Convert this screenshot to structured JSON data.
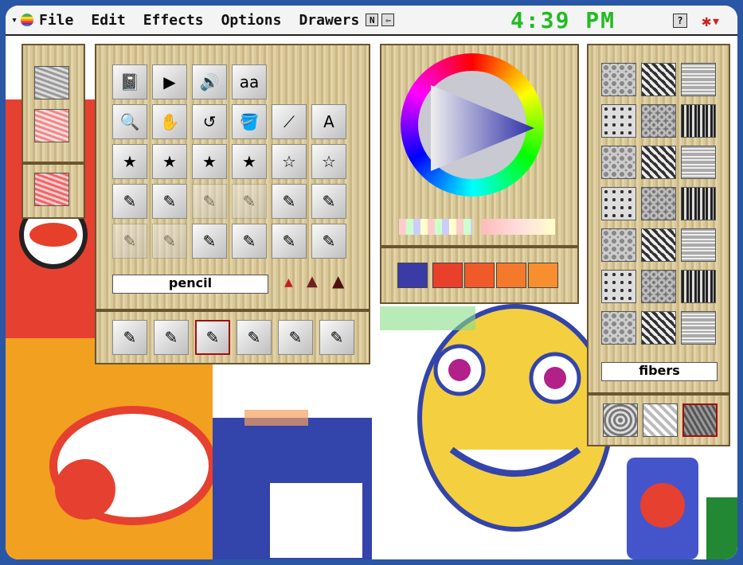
{
  "menu": {
    "items": [
      "File",
      "Edit",
      "Effects",
      "Options",
      "Drawers"
    ],
    "clock": "4:39 PM"
  },
  "tools_drawer": {
    "selected_label": "pencil",
    "tools": [
      "notebook-icon",
      "play-icon",
      "speaker-icon",
      "text-icon",
      "magnifier-icon",
      "hand-icon",
      "undo-icon",
      "paint-bucket-icon",
      "eyedropper-icon",
      "stamp-icon",
      "star-stamp-1",
      "star-stamp-2",
      "star-stamp-3",
      "star-stamp-4",
      "star-stamp-5",
      "star-stamp-6",
      "marker-icon",
      "glitter-icon",
      "drip-icon",
      "tube-icon",
      "brush-icon",
      "ink-bottle-icon",
      "crayon-icon",
      "chalk-icon",
      "brush-2-icon",
      "pen-icon",
      "nib-icon",
      "brush-3-icon"
    ],
    "bottom_tools": [
      "paint-brush-icon",
      "green-pencil-icon",
      "pencil-icon",
      "water-drop-icon",
      "crayon-icon",
      "spray-can-icon"
    ]
  },
  "color": {
    "selected": "#3b3ba6",
    "recent": [
      "#e8402a",
      "#f05a28",
      "#f4792a",
      "#f78f2e"
    ]
  },
  "textures_drawer": {
    "selected_label": "fibers"
  },
  "colors": {
    "frame": "#2a56a6",
    "clock": "#22bb22"
  }
}
